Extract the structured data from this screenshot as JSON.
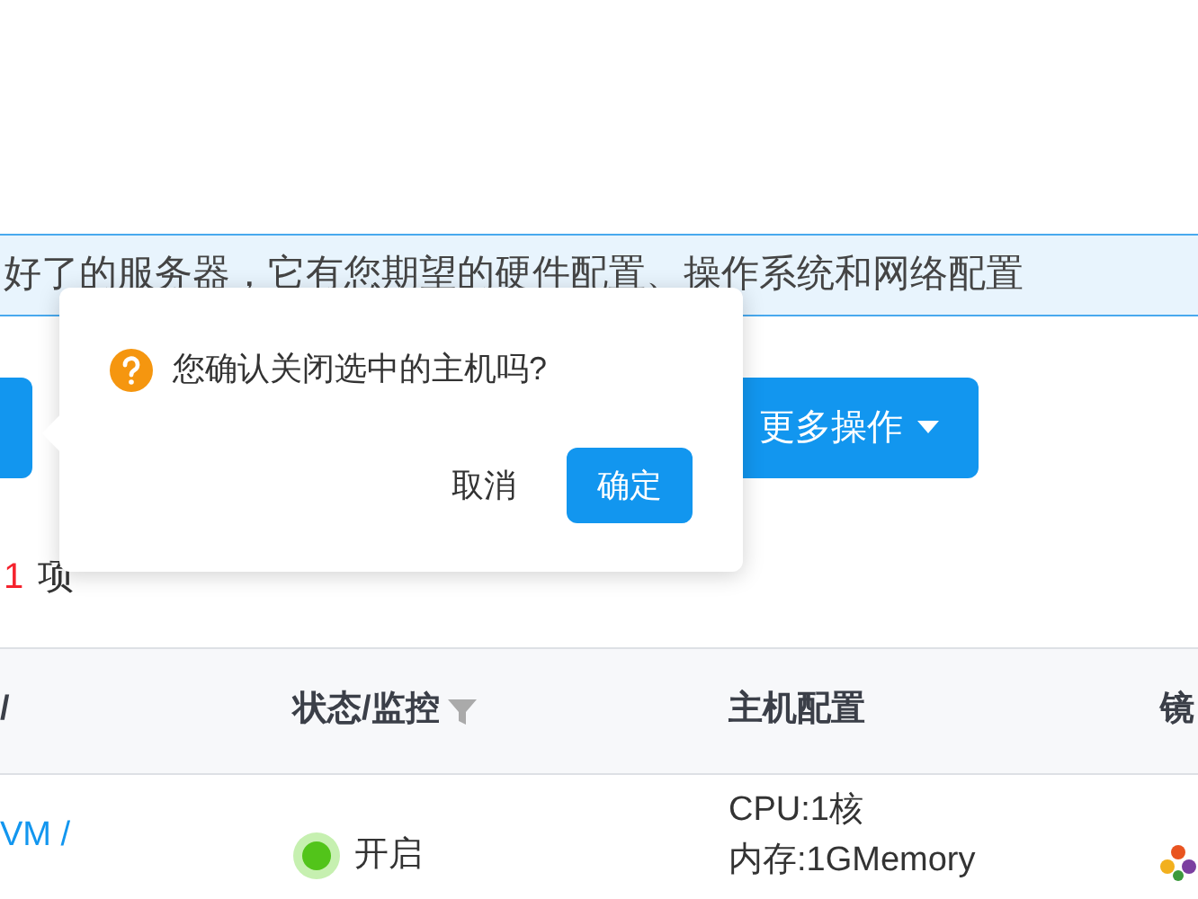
{
  "banner": {
    "text": "好了的服务器，它有您期望的硬件配置、操作系统和网络配置"
  },
  "toolbar": {
    "more_button": "更多操作"
  },
  "popconfirm": {
    "message": "您确认关闭选中的主机吗?",
    "cancel": "取消",
    "confirm": "确定"
  },
  "count": {
    "value": "1",
    "unit": "项"
  },
  "table": {
    "columns": [
      {
        "label": "/",
        "filterable": false
      },
      {
        "label": "状态/监控",
        "filterable": true
      },
      {
        "label": "主机配置",
        "filterable": false
      },
      {
        "label": "镜",
        "filterable": false
      }
    ],
    "rows": [
      {
        "name": "VM /",
        "status": "开启",
        "on": true,
        "config": [
          "CPU:1核",
          "内存:1GMemory"
        ]
      }
    ]
  }
}
